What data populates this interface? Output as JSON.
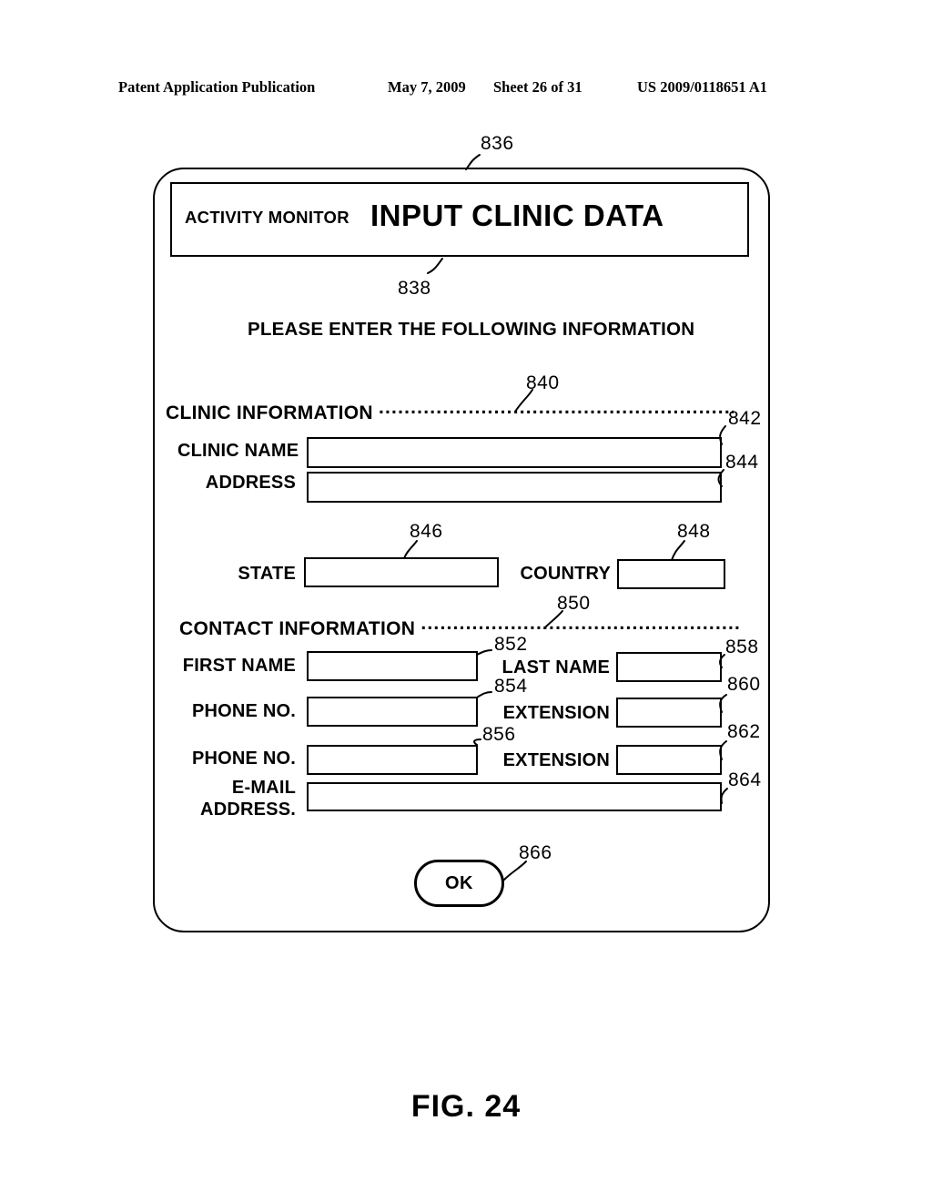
{
  "page_header": {
    "publication": "Patent Application Publication",
    "date": "May 7, 2009",
    "sheet": "Sheet 26 of 31",
    "patent_number": "US 2009/0118651 A1"
  },
  "figure": {
    "caption": "FIG. 24"
  },
  "dialog": {
    "ref": "836",
    "title_bar": {
      "ref": "838",
      "app_label": "ACTIVITY MONITOR",
      "screen_title": "INPUT CLINIC DATA"
    },
    "instruction": "PLEASE ENTER THE FOLLOWING INFORMATION",
    "sections": [
      {
        "name": "clinic-information",
        "heading": "CLINIC  INFORMATION",
        "leader_ref": "840",
        "dots": "................................................................",
        "fields": [
          {
            "name": "clinic-name",
            "label": "CLINIC NAME",
            "value": "",
            "ref": "842"
          },
          {
            "name": "address",
            "label": "ADDRESS",
            "value": "",
            "ref": "844"
          },
          {
            "name": "state",
            "label": "STATE",
            "value": "",
            "ref": "846"
          },
          {
            "name": "country",
            "label": "COUNTRY",
            "value": "",
            "ref": "848"
          }
        ]
      },
      {
        "name": "contact-information",
        "heading": "CONTACT  INFORMATION",
        "leader_ref": "850",
        "dots": "...........................................................",
        "fields": [
          {
            "name": "first-name",
            "label": "FIRST NAME",
            "value": "",
            "ref": "852"
          },
          {
            "name": "last-name",
            "label": "LAST NAME",
            "value": "",
            "ref": "858"
          },
          {
            "name": "phone-no-1",
            "label": "PHONE NO.",
            "value": "",
            "ref": "854"
          },
          {
            "name": "extension-1",
            "label": "EXTENSION",
            "value": "",
            "ref": "860"
          },
          {
            "name": "phone-no-2",
            "label": "PHONE NO.",
            "value": "",
            "ref": "856"
          },
          {
            "name": "extension-2",
            "label": "EXTENSION",
            "value": "",
            "ref": "862"
          },
          {
            "name": "email-address",
            "label_line1": "E-MAIL",
            "label_line2": "ADDRESS.",
            "value": "",
            "ref": "864"
          }
        ]
      }
    ],
    "ok_button": {
      "label": "OK",
      "ref": "866"
    }
  },
  "colors": {
    "ink": "#000000",
    "paper": "#ffffff"
  }
}
